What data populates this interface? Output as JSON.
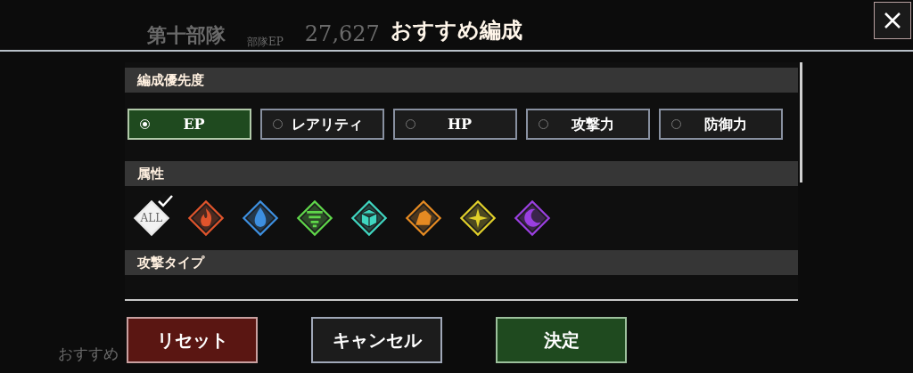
{
  "background": {
    "team_name": "第十部隊",
    "ep_label": "部隊EP",
    "ep_value": "27,627",
    "corner_label": "おすすめ"
  },
  "dialog": {
    "title": "おすすめ編成",
    "sections": [
      {
        "kind": "options",
        "title": "編成優先度",
        "options": [
          {
            "label": "EP",
            "selected": true
          },
          {
            "label": "レアリティ",
            "selected": false
          },
          {
            "label": "HP",
            "selected": false
          },
          {
            "label": "攻撃力",
            "selected": false
          },
          {
            "label": "防御力",
            "selected": false
          }
        ]
      },
      {
        "kind": "elements",
        "title": "属性",
        "elements": [
          {
            "kind": "all",
            "label": "ALL",
            "selected": true
          },
          {
            "kind": "fire",
            "color": "#e0542c",
            "selected": false
          },
          {
            "kind": "water",
            "color": "#3d8fe0",
            "selected": false
          },
          {
            "kind": "wind",
            "color": "#5fd64a",
            "selected": false
          },
          {
            "kind": "cube",
            "color": "#3fd6c0",
            "selected": false
          },
          {
            "kind": "rock",
            "color": "#e58a22",
            "selected": false
          },
          {
            "kind": "star",
            "color": "#e0cf2a",
            "selected": false
          },
          {
            "kind": "moon",
            "color": "#9a3fe0",
            "selected": false
          }
        ]
      },
      {
        "kind": "header",
        "title": "攻撃タイプ"
      }
    ],
    "buttons": [
      {
        "kind": "reset",
        "label": "リセット"
      },
      {
        "kind": "cancel",
        "label": "キャンセル"
      },
      {
        "kind": "confirm",
        "label": "決定"
      }
    ]
  }
}
